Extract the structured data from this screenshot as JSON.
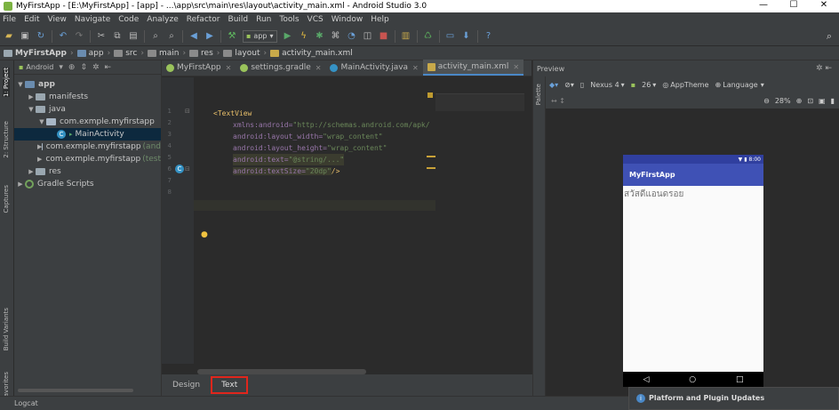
{
  "window": {
    "title": "MyFirstApp - [E:\\MyFirstApp] - [app] - ...\\app\\src\\main\\res\\layout\\activity_main.xml - Android Studio 3.0",
    "controls": [
      "—",
      "☐",
      "✕"
    ]
  },
  "menu": [
    "File",
    "Edit",
    "View",
    "Navigate",
    "Code",
    "Analyze",
    "Refactor",
    "Build",
    "Run",
    "Tools",
    "VCS",
    "Window",
    "Help"
  ],
  "toolbar": {
    "run_config": "app"
  },
  "breadcrumb": [
    {
      "label": "MyFirstApp"
    },
    {
      "label": "app"
    },
    {
      "label": "src"
    },
    {
      "label": "main"
    },
    {
      "label": "res"
    },
    {
      "label": "layout"
    },
    {
      "label": "activity_main.xml"
    }
  ],
  "tool_windows": {
    "project": "1: Project",
    "structure": "2: Structure",
    "captures": "Captures",
    "build_variants": "Build Variants",
    "favorites": "Favorites"
  },
  "project": {
    "view_mode": "Android",
    "tree": [
      {
        "label": "app"
      },
      {
        "label": "manifests"
      },
      {
        "label": "java"
      },
      {
        "label": "com.exmple.myfirstapp"
      },
      {
        "label": "MainActivity"
      },
      {
        "label": "com.exmple.myfirstapp",
        "suffix": "(and"
      },
      {
        "label": "com.exmple.myfirstapp",
        "suffix": "(test"
      },
      {
        "label": "res"
      },
      {
        "label": "Gradle Scripts"
      }
    ]
  },
  "editor": {
    "tabs": [
      {
        "label": "MyFirstApp"
      },
      {
        "label": "settings.gradle"
      },
      {
        "label": "MainActivity.java"
      },
      {
        "label": "activity_main.xml"
      }
    ],
    "line_numbers": [
      "1",
      "2",
      "3",
      "4",
      "5",
      "6",
      "7",
      "8"
    ],
    "code": {
      "tag_open": "<TextView",
      "xmlns_attr": "xmlns:android=",
      "xmlns_val": "\"http://schemas.android.com/apk/",
      "width_attr": "android:layout_width=",
      "width_val": "\"wrap_content\"",
      "height_attr": "android:layout_height=",
      "height_val": "\"wrap_content\"",
      "text_attr": "android:text=",
      "text_val": "\"@string/...\"",
      "size_attr": "android:textSize=",
      "size_val": "\"20dp\"",
      "tag_close": "/>"
    },
    "bottom_tabs": {
      "design": "Design",
      "text": "Text"
    }
  },
  "preview": {
    "title": "Preview",
    "palette": "Palette",
    "device": "Nexus 4",
    "api": "26",
    "theme": "AppTheme",
    "language": "Language",
    "zoom": "28%",
    "phone": {
      "time": "8:00",
      "app_title": "MyFirstApp",
      "text": "สวัสดีแอนดรอย",
      "nav": [
        "◁",
        "○",
        "□"
      ]
    }
  },
  "notification": {
    "title": "Platform and Plugin Updates"
  },
  "statusbar": {
    "logcat": "Logcat"
  }
}
